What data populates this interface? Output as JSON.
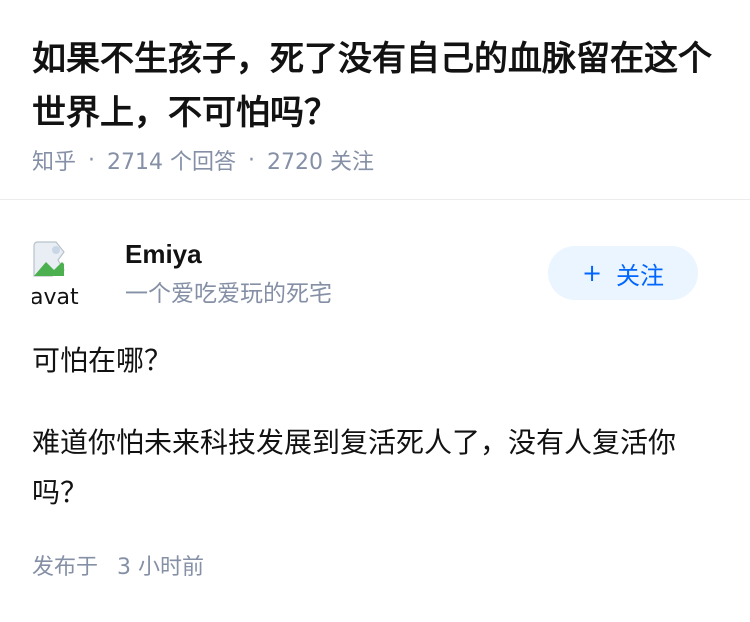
{
  "question": {
    "title": "如果不生孩子，死了没有自己的血脉留在这个世界上，不可怕吗？",
    "source": "知乎",
    "answer_count_label": "2714 个回答",
    "follow_count_label": "2720 关注",
    "separator": "·"
  },
  "answer": {
    "author": {
      "name": "Emiya",
      "bio": "一个爱吃爱玩的死宅",
      "avatar_alt": "avatar"
    },
    "follow_button": {
      "icon": "plus-icon",
      "icon_glyph": "+",
      "label": "关注"
    },
    "paragraphs": [
      "可怕在哪？",
      "难道你怕未来科技发展到复活死人了，没有人复活你吗？"
    ],
    "time_prefix": "发布于",
    "time_value": "3 小时前"
  },
  "colors": {
    "title": "#121212",
    "meta": "#8590a6",
    "follow_bg": "#ebf5ff",
    "follow_text": "#0066ff",
    "divider": "#ececec"
  }
}
